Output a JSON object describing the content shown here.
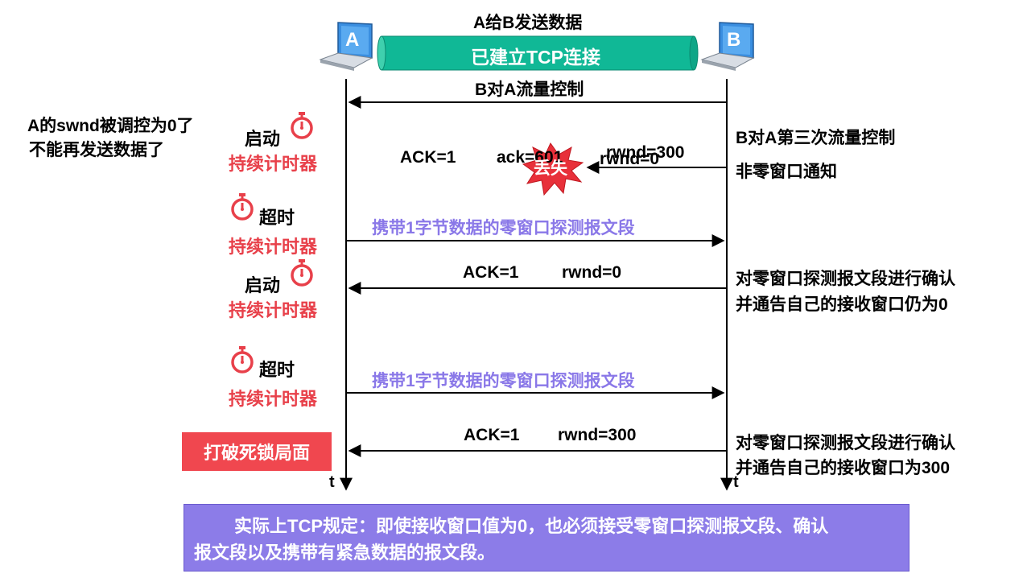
{
  "title": "A给B发送数据",
  "connection_label": "已建立TCP连接",
  "host_a": {
    "label": "A"
  },
  "host_b": {
    "label": "B"
  },
  "flow_control_label": "B对A流量控制",
  "left_note": {
    "line1": "A的swnd被调控为0了",
    "line2": "不能再发送数据了"
  },
  "timer_blocks": [
    {
      "action": "启动",
      "name": "持续计时器"
    },
    {
      "action": "超时",
      "name": "持续计时器"
    },
    {
      "action": "启动",
      "name": "持续计时器"
    },
    {
      "action": "超时",
      "name": "持续计时器"
    }
  ],
  "lost_segment": {
    "ack": "ACK=1",
    "ack_num": "ack=601",
    "rwnd_new": "rwnd=300",
    "rwnd_old": "rwnd=0",
    "lost_label": "丢失"
  },
  "right_note1": {
    "line1": "B对A第三次流量控制",
    "line2": "非零窗口通知"
  },
  "probe_label_1": "携带1字节数据的零窗口探测报文段",
  "reply1": {
    "ack": "ACK=1",
    "rwnd": "rwnd=0"
  },
  "right_note2": {
    "line1": "对零窗口探测报文段进行确认",
    "line2": "并通告自己的接收窗口仍为0"
  },
  "probe_label_2": "携带1字节数据的零窗口探测报文段",
  "reply2": {
    "ack": "ACK=1",
    "rwnd": "rwnd=300"
  },
  "right_note3": {
    "line1": "对零窗口探测报文段进行确认",
    "line2": "并通告自己的接收窗口为300"
  },
  "break_deadlock_label": "打破死锁局面",
  "time_axis_label": "t",
  "footer_note": {
    "line1": "实际上TCP规定：即使接收窗口值为0，也必须接受零窗口探测报文段、确认",
    "line2": "报文段以及携带有紧急数据的报文段。"
  },
  "colors": {
    "red": "#e8404a",
    "purple": "#8a78e8",
    "pipe": "#10b896",
    "note_bg": "#8c7ce8"
  },
  "icons": [
    "laptop-icon",
    "stopwatch-icon",
    "explosion-icon"
  ]
}
